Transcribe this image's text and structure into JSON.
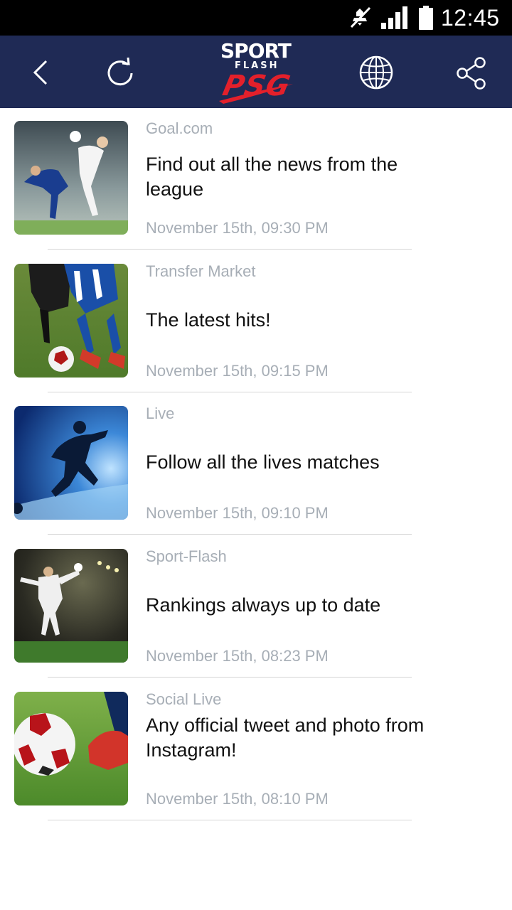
{
  "status_bar": {
    "time": "12:45",
    "icons": [
      "mute-icon",
      "signal-icon",
      "battery-icon"
    ]
  },
  "toolbar": {
    "logo": {
      "line1": "SPORT",
      "line2": "FLASH",
      "line3": "PSG"
    },
    "buttons": [
      "back-icon",
      "refresh-icon",
      "globe-icon",
      "share-icon"
    ],
    "colors": {
      "bar": "#1f2a55",
      "logo_accent": "#e3202b"
    }
  },
  "news": [
    {
      "source": "Goal.com",
      "title": "Find out all the news from the league",
      "time": "November 15th, 09:30 PM"
    },
    {
      "source": "Transfer Market",
      "title": "The latest hits!",
      "time": "November 15th, 09:15 PM"
    },
    {
      "source": "Live",
      "title": "Follow all the lives matches",
      "time": "November 15th, 09:10 PM"
    },
    {
      "source": "Sport-Flash",
      "title": "Rankings always up to date",
      "time": "November 15th, 08:23 PM"
    },
    {
      "source": "Social Live",
      "title": "Any official tweet and photo from Instagram!",
      "time": "November 15th, 08:10 PM"
    }
  ]
}
